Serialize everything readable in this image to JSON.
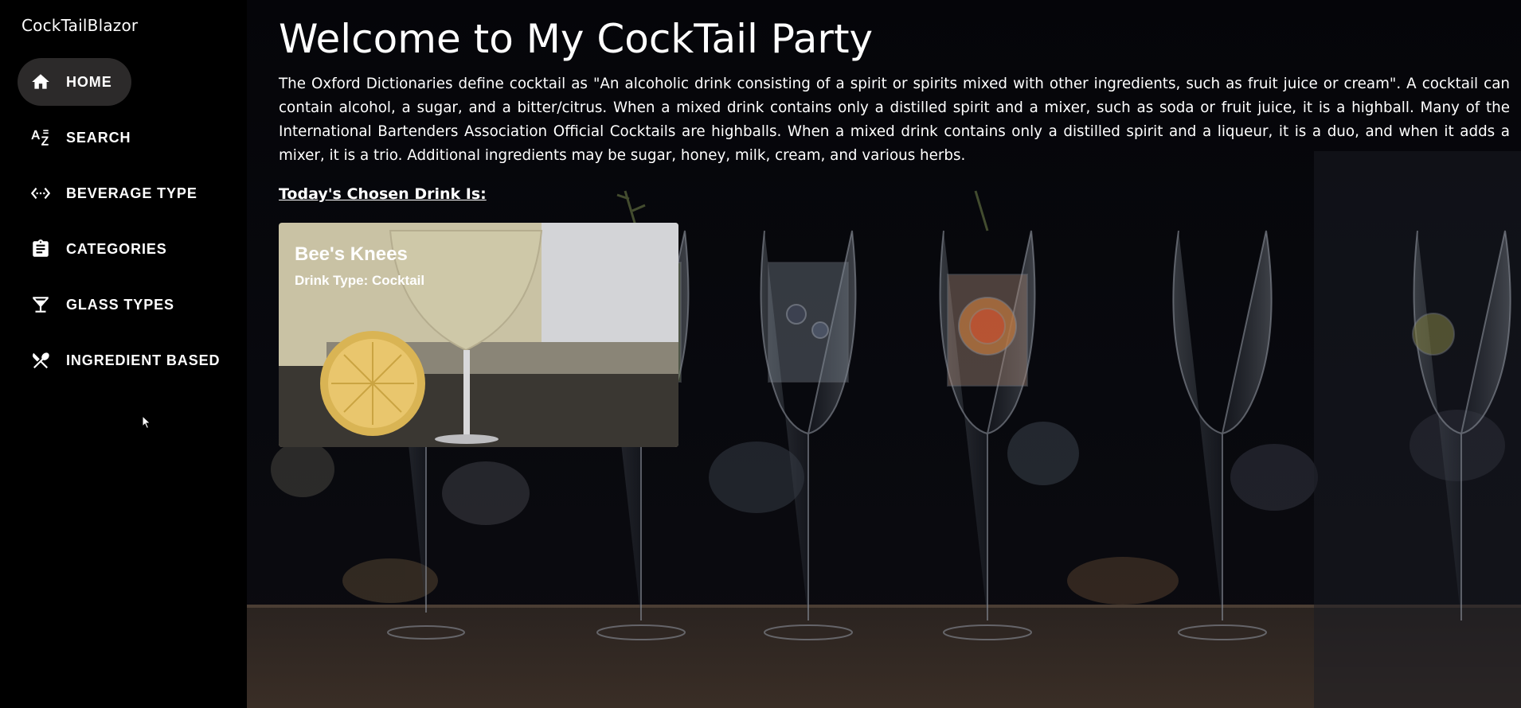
{
  "app": {
    "title": "CockTailBlazor"
  },
  "sidebar": {
    "items": [
      {
        "label": "HOME",
        "icon": "home-icon",
        "active": true
      },
      {
        "label": "SEARCH",
        "icon": "sort-alpha-icon",
        "active": false
      },
      {
        "label": "BEVERAGE TYPE",
        "icon": "settings-ethernet-icon",
        "active": false
      },
      {
        "label": "CATEGORIES",
        "icon": "clipboard-icon",
        "active": false
      },
      {
        "label": "GLASS TYPES",
        "icon": "cocktail-glass-icon",
        "active": false
      },
      {
        "label": "INGREDIENT BASED",
        "icon": "utensils-icon",
        "active": false
      }
    ]
  },
  "main": {
    "title": "Welcome to My CockTail Party",
    "intro": "The Oxford Dictionaries define cocktail as \"An alcoholic drink consisting of a spirit or spirits mixed with other ingredients, such as fruit juice or cream\". A cocktail can contain alcohol, a sugar, and a bitter/citrus. When a mixed drink contains only a distilled spirit and a mixer, such as soda or fruit juice, it is a highball. Many of the International Bartenders Association Official Cocktails are highballs. When a mixed drink contains only a distilled spirit and a liqueur, it is a duo, and when it adds a mixer, it is a trio. Additional ingredients may be sugar, honey, milk, cream, and various herbs.",
    "chosen_label": "Today's Chosen Drink Is:",
    "drink": {
      "name": "Bee's Knees",
      "type_text": "Drink Type: Cocktail"
    }
  },
  "colors": {
    "sidebar_bg": "#000000",
    "active_item_bg": "#2c2a2a",
    "page_bg": "#050508",
    "text": "#ffffff"
  }
}
